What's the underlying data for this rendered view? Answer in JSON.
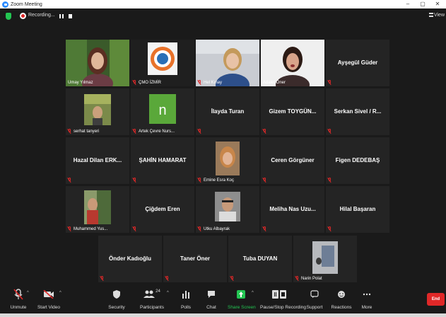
{
  "window": {
    "title": "Zoom Meeting",
    "controls": [
      "–",
      "ð",
      "✕"
    ]
  },
  "recording": {
    "status": "Recording..."
  },
  "view": {
    "label": "View"
  },
  "participants_tiles": [
    {
      "name": "Umay Yılmaz",
      "video": true,
      "muted": false
    },
    {
      "name": "ÇMO İZMİR",
      "video": true,
      "muted": true
    },
    {
      "name": "Hel Kınay",
      "video": true,
      "muted": true
    },
    {
      "name": "Adalet Öner",
      "video": true,
      "muted": false,
      "speaking": true
    },
    {
      "name": "Ayşegül Güder",
      "video": false,
      "muted": true
    },
    {
      "name": "serhat tanyeri",
      "video": true,
      "muted": true
    },
    {
      "name": "Artek Çevre Nurs...",
      "video": true,
      "muted": true,
      "avatar_letter": "n"
    },
    {
      "name": "İlayda Turan",
      "video": false,
      "muted": true
    },
    {
      "name": "Gizem TOYGÜN...",
      "video": false,
      "muted": true
    },
    {
      "name": "Serkan Sivel / R...",
      "video": false,
      "muted": true
    },
    {
      "name": "Hazal Dilan ERK...",
      "video": false,
      "muted": true
    },
    {
      "name": "ŞAHİN HAMARAT",
      "video": false,
      "muted": true
    },
    {
      "name": "Emine Esra Koç",
      "video": true,
      "muted": true
    },
    {
      "name": "Ceren Görgüner",
      "video": false,
      "muted": true
    },
    {
      "name": "Figen DEDEBAŞ",
      "video": false,
      "muted": true
    },
    {
      "name": "Muhammed Yus...",
      "video": true,
      "muted": true
    },
    {
      "name": "Çiğdem Eren",
      "video": false,
      "muted": true
    },
    {
      "name": "Utku Albayrak",
      "video": true,
      "muted": true
    },
    {
      "name": "Meliha Nas Uzu...",
      "video": false,
      "muted": true
    },
    {
      "name": "Hilal Başaran",
      "video": false,
      "muted": true
    },
    {
      "name": "Önder Kadıoğlu",
      "video": false,
      "muted": true
    },
    {
      "name": "Taner Öner",
      "video": false,
      "muted": true
    },
    {
      "name": "Tuba DUYAN",
      "video": false,
      "muted": true
    },
    {
      "name": "Narin Polat",
      "video": true,
      "muted": true
    }
  ],
  "toolbar": {
    "unmute": "Unmute",
    "start_video": "Start Video",
    "security": "Security",
    "participants": "Participants",
    "participants_count": "24",
    "polls": "Polls",
    "chat": "Chat",
    "share_screen": "Share Screen",
    "pause_stop_recording": "Pause/Stop Recording",
    "support": "Support",
    "reactions": "Reactions",
    "more": "More",
    "end": "End"
  },
  "colors": {
    "background": "#1a1a1a",
    "tile": "#242424",
    "speaking_outline": "#9fd356",
    "share_green": "#23c552",
    "end_red": "#e02828",
    "muted_red": "#e02828"
  }
}
